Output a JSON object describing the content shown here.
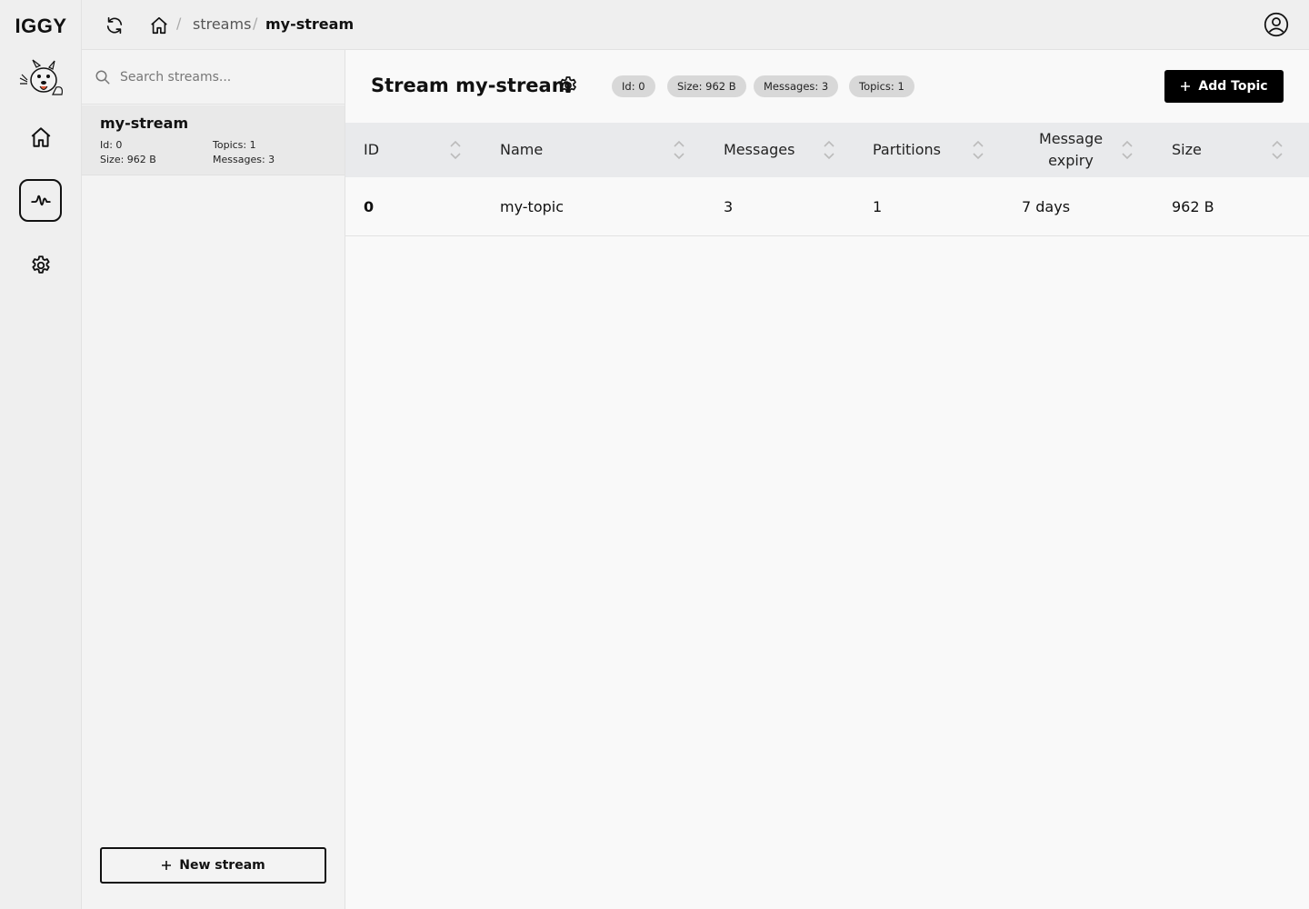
{
  "app": {
    "logo": "IGGY"
  },
  "breadcrumb": {
    "streams": "streams",
    "current": "my-stream",
    "separator": "/"
  },
  "sidebar": {
    "search_placeholder": "Search streams...",
    "streams": [
      {
        "name": "my-stream",
        "id": "Id: 0",
        "size": "Size: 962 B",
        "topics": "Topics: 1",
        "messages": "Messages: 3"
      }
    ],
    "new_stream_label": "New stream"
  },
  "main": {
    "title": "Stream my-stream",
    "badges": {
      "id": "Id: 0",
      "size": "Size: 962 B",
      "messages": "Messages: 3",
      "topics": "Topics: 1"
    },
    "add_topic_label": "Add Topic",
    "table": {
      "columns": [
        "ID",
        "Name",
        "Messages",
        "Partitions",
        "Message expiry",
        "Size"
      ],
      "rows": [
        {
          "id": "0",
          "name": "my-topic",
          "messages": "3",
          "partitions": "1",
          "expiry": "7 days",
          "size": "962 B"
        }
      ]
    }
  },
  "icons": {
    "rail": [
      "home-icon",
      "activity-icon",
      "gear-icon"
    ],
    "topbar": [
      "refresh-icon",
      "home-icon",
      "user-circle-icon"
    ]
  },
  "colors": {
    "accent": "#000000",
    "badge": "#d8d8d8",
    "table_header": "#e9eaec"
  }
}
